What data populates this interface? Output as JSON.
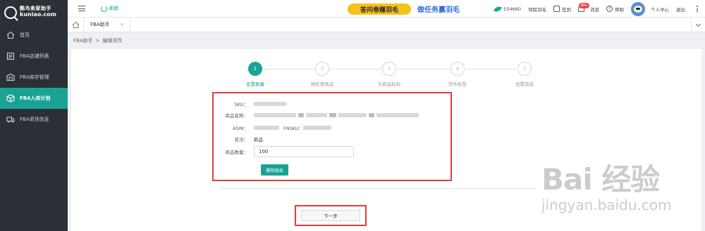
{
  "sidebar": {
    "logo": {
      "title": "酷鸟卖家助手",
      "domain": "kuniao.com"
    },
    "items": [
      {
        "label": "首页",
        "icon": "home-icon",
        "active": false
      },
      {
        "label": "FBA店铺列表",
        "icon": "store-list-icon",
        "active": false
      },
      {
        "label": "FBA库存管理",
        "icon": "inventory-icon",
        "active": false
      },
      {
        "label": "FBA入库计划",
        "icon": "cube-icon",
        "active": true
      },
      {
        "label": "FBA退货信息",
        "icon": "return-truck-icon",
        "active": false
      }
    ]
  },
  "header": {
    "refresh_label": "刷新",
    "banner1": "答问卷赚羽毛",
    "banner2": "做任务赢羽毛",
    "feather_count": "534660",
    "claim_label": "领取羽毛",
    "checkin_label": "签到",
    "message_label": "消息",
    "message_badge": "99+",
    "help_label": "帮助",
    "user_center_label": "个人中心",
    "logout_label": "退出"
  },
  "tabs": {
    "active_tab": "FBA助手",
    "close_glyph": "×"
  },
  "breadcrumb": {
    "root": "FBA助手",
    "separator": ">",
    "current": "编辑货件"
  },
  "steps": [
    {
      "number": "1",
      "label": "设置数量",
      "active": true
    },
    {
      "number": "2",
      "label": "预处理商品",
      "active": false
    },
    {
      "number": "3",
      "label": "为商品贴标",
      "active": false
    },
    {
      "number": "4",
      "label": "货件标签",
      "active": false
    },
    {
      "number": "5",
      "label": "设置完成",
      "active": false
    }
  ],
  "form": {
    "sku_label": "SKU：",
    "name_label": "商品名称：",
    "asin_label": "ASIN：",
    "fnsku_label": "FNSKU：",
    "status_label": "状况：",
    "status_value": "新品",
    "qty_label": "商品数量：",
    "qty_value": "100",
    "delete_button": "删除商品"
  },
  "next_button": "下一步",
  "watermark": {
    "line1": "Bai 经验",
    "line2": "jingyan.baidu.com"
  }
}
